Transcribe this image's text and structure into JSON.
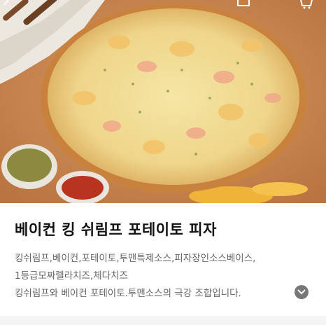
{
  "header": {
    "back_icon": "chevron-left-icon",
    "share_icon": "share-icon",
    "cart_icon": "cart-icon"
  },
  "product": {
    "image_description_icon": "pizza-photo",
    "title": "베이컨 킹 쉬림프 포테이토 피자",
    "ingredients_line1": "킹쉬림프,베이컨,포테이토,투맨특제소스,피자장인소스베이스,",
    "ingredients_line2": "1등급모짜렐라치즈,체다치즈",
    "description": "킹쉬림프와 베이컨 포테이토.투맨소스의 극강 조합입니다.",
    "expand_icon": "chevron-down-icon"
  },
  "colors": {
    "title": "#111111",
    "text": "#666666",
    "expand_button": "#777777"
  }
}
